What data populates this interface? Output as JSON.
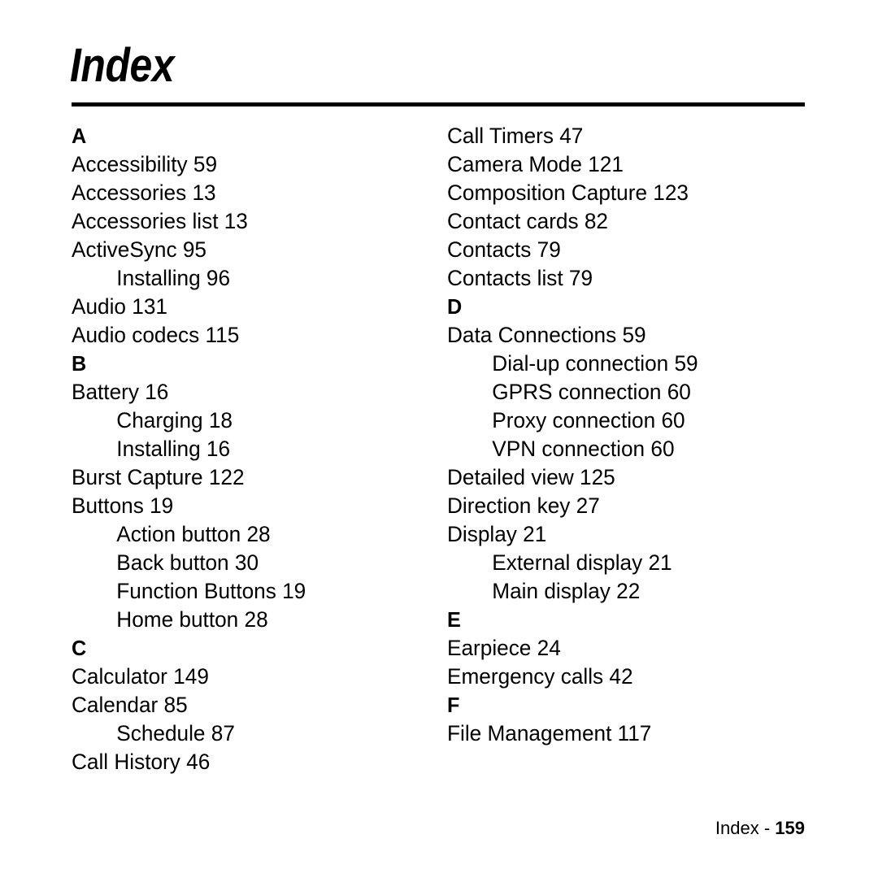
{
  "document": {
    "title": "Index",
    "footer": {
      "label": "Index - ",
      "page_number": "159"
    }
  },
  "columns": {
    "left": [
      {
        "type": "section",
        "text": "A"
      },
      {
        "type": "entry",
        "text": "Accessibility 59"
      },
      {
        "type": "entry",
        "text": "Accessories 13"
      },
      {
        "type": "entry",
        "text": "Accessories list 13"
      },
      {
        "type": "entry",
        "text": "ActiveSync 95"
      },
      {
        "type": "sub",
        "text": "Installing 96"
      },
      {
        "type": "entry",
        "text": "Audio 131"
      },
      {
        "type": "entry",
        "text": "Audio codecs 115"
      },
      {
        "type": "section",
        "text": "B"
      },
      {
        "type": "entry",
        "text": "Battery 16"
      },
      {
        "type": "sub",
        "text": "Charging 18"
      },
      {
        "type": "sub",
        "text": "Installing 16"
      },
      {
        "type": "entry",
        "text": "Burst Capture 122"
      },
      {
        "type": "entry",
        "text": "Buttons 19"
      },
      {
        "type": "sub",
        "text": "Action button 28"
      },
      {
        "type": "sub",
        "text": "Back button 30"
      },
      {
        "type": "sub",
        "text": "Function Buttons 19"
      },
      {
        "type": "sub",
        "text": "Home button 28"
      },
      {
        "type": "section",
        "text": "C"
      },
      {
        "type": "entry",
        "text": "Calculator 149"
      },
      {
        "type": "entry",
        "text": "Calendar 85"
      },
      {
        "type": "sub",
        "text": "Schedule 87"
      },
      {
        "type": "entry",
        "text": "Call History 46"
      }
    ],
    "right": [
      {
        "type": "entry",
        "text": "Call Timers 47"
      },
      {
        "type": "entry",
        "text": "Camera Mode 121"
      },
      {
        "type": "entry",
        "text": "Composition Capture 123"
      },
      {
        "type": "entry",
        "text": "Contact cards 82"
      },
      {
        "type": "entry",
        "text": "Contacts 79"
      },
      {
        "type": "entry",
        "text": "Contacts list 79"
      },
      {
        "type": "section",
        "text": "D"
      },
      {
        "type": "entry",
        "text": "Data Connections 59"
      },
      {
        "type": "sub",
        "text": "Dial-up connection 59"
      },
      {
        "type": "sub",
        "text": "GPRS connection 60"
      },
      {
        "type": "sub",
        "text": "Proxy connection 60"
      },
      {
        "type": "sub",
        "text": "VPN connection 60"
      },
      {
        "type": "entry",
        "text": "Detailed view 125"
      },
      {
        "type": "entry",
        "text": "Direction key 27"
      },
      {
        "type": "entry",
        "text": "Display 21"
      },
      {
        "type": "sub",
        "text": "External display 21"
      },
      {
        "type": "sub",
        "text": "Main display 22"
      },
      {
        "type": "section",
        "text": "E"
      },
      {
        "type": "entry",
        "text": "Earpiece 24"
      },
      {
        "type": "entry",
        "text": "Emergency calls 42"
      },
      {
        "type": "section",
        "text": "F"
      },
      {
        "type": "entry",
        "text": "File Management 117"
      }
    ]
  }
}
